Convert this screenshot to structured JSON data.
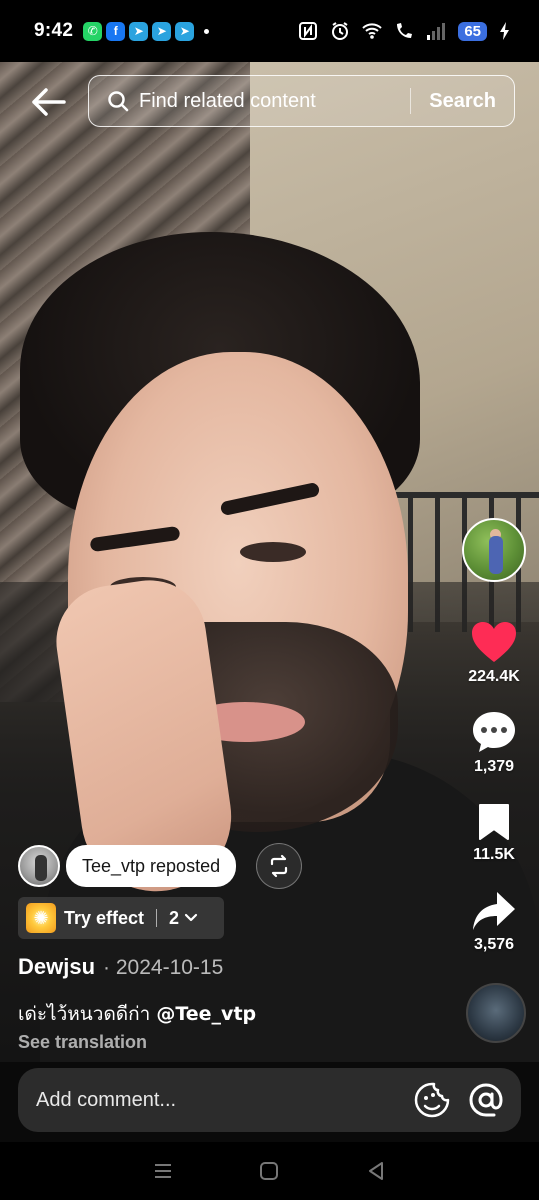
{
  "status_bar": {
    "time": "9:42",
    "battery": "65",
    "app_icons": [
      "whatsapp-icon",
      "facebook-icon",
      "telegram-icon",
      "telegram-icon",
      "telegram-icon"
    ]
  },
  "search": {
    "placeholder": "Find related content",
    "button_label": "Search"
  },
  "rail": {
    "likes": "224.4K",
    "comments": "1,379",
    "saves": "11.5K",
    "shares": "3,576",
    "like_color": "#fe2c55"
  },
  "repost": {
    "label": "Tee_vtp reposted"
  },
  "effect": {
    "label": "Try effect",
    "count": "2"
  },
  "post": {
    "author": "Dewjsu",
    "date": "· 2024-10-15",
    "caption_text": "เด่ะไว้หนวดดีก่า ",
    "caption_mention": "@Tee_vtp",
    "see_translation": "See translation"
  },
  "comment": {
    "placeholder": "Add comment..."
  }
}
